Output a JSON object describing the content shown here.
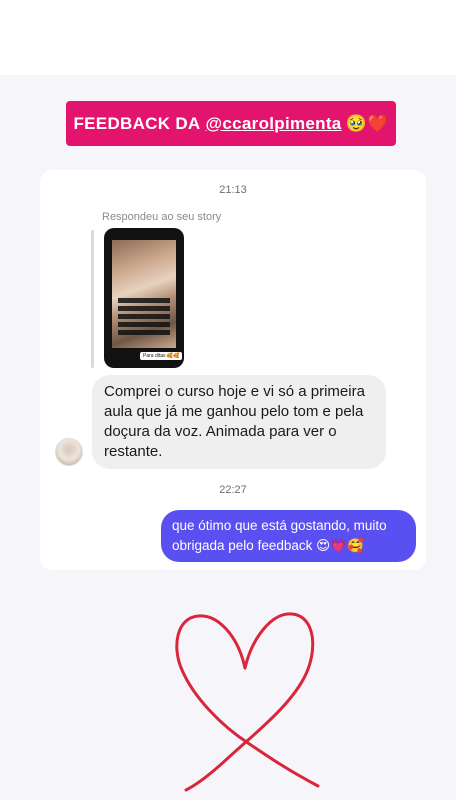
{
  "banner": {
    "prefix": "FEEDBACK DA",
    "handle": "@ccarolpimenta",
    "emoji": "🥹❤️"
  },
  "chat": {
    "timestamp_1": "21:13",
    "reply_label": "Respondeu ao seu story",
    "story_thumbnail_caption": "Para ditas 🥰🥰",
    "incoming_message": "Comprei o curso hoje e vi só a primeira aula que  já me ganhou pelo tom e pela doçura da voz.  Animada para ver o restante.",
    "timestamp_2": "22:27",
    "outgoing_message": "que ótimo que está gostando, muito obrigada pelo feedback 😍💗🥰"
  },
  "colors": {
    "banner_bg": "#e3146e",
    "outgoing_bubble": "#5a4ff0",
    "incoming_bubble": "#efefef",
    "heart_stroke": "#d9263a"
  },
  "icons": {
    "heart_drawing": "heart-doodle-icon"
  }
}
